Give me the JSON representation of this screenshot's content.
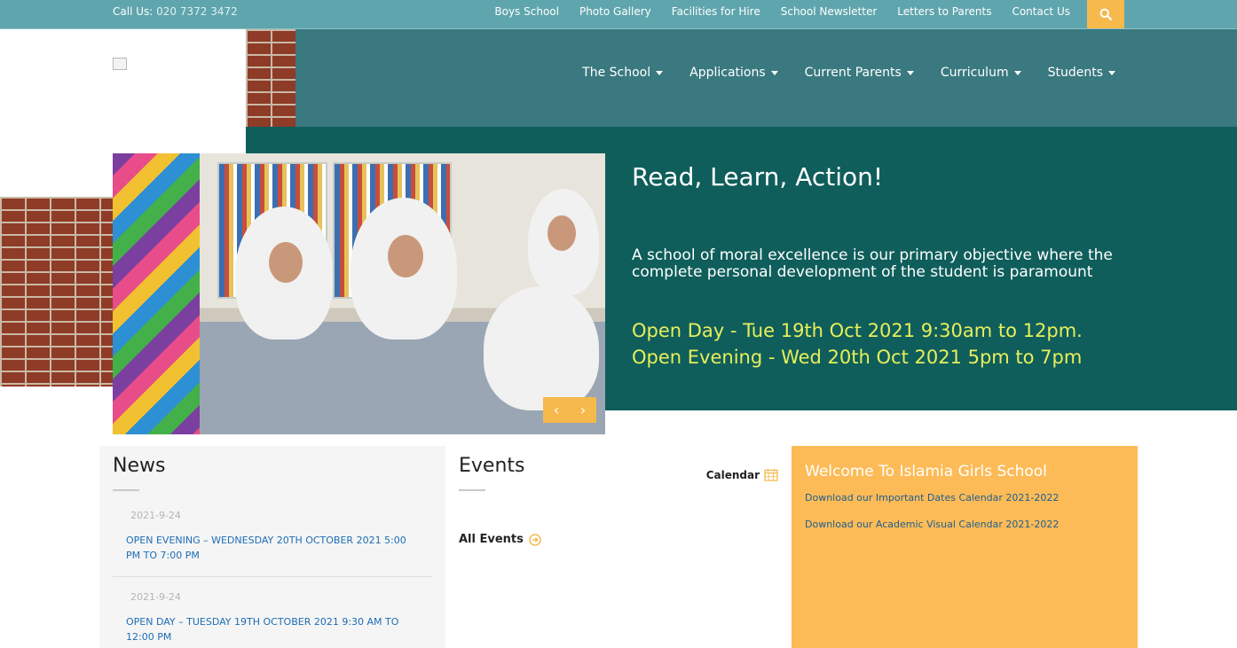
{
  "topbar": {
    "call_label": "Call Us:",
    "call_number": "020 7372 3472",
    "links": [
      "Boys School",
      "Photo Gallery",
      "Facilities for Hire",
      "School Newsletter",
      "Letters to Parents",
      "Contact Us"
    ]
  },
  "nav": {
    "items": [
      "The School",
      "Applications",
      "Current Parents",
      "Curriculum",
      "Students"
    ]
  },
  "hero": {
    "title": "Read, Learn, Action!",
    "description": "A school of moral excellence is our primary objective where the complete personal development of the student is paramount",
    "open_day": "Open Day - Tue 19th Oct 2021 9:30am to 12pm.",
    "open_evening": "Open Evening - Wed 20th Oct 2021 5pm to 7pm",
    "prev_glyph": "‹",
    "next_glyph": "›"
  },
  "news": {
    "title": "News",
    "items": [
      {
        "date": "2021-9-24",
        "text": "OPEN EVENING – WEDNESDAY 20TH OCTOBER 2021 5:00 PM TO 7:00 PM"
      },
      {
        "date": "2021-9-24",
        "text": "OPEN DAY – TUESDAY 19TH OCTOBER 2021  9:30 AM TO 12:00 PM"
      }
    ]
  },
  "events": {
    "title": "Events",
    "calendar_label": "Calendar",
    "all_events_label": "All Events"
  },
  "welcome": {
    "title": "Welcome To Islamia Girls School",
    "links": [
      "Download our Important Dates Calendar 2021-2022",
      "Download our Academic Visual Calendar 2021-2022"
    ]
  },
  "colors": {
    "topbar": "#5fa5ad",
    "header": "#39797f",
    "hero": "#0f5e5b",
    "accent": "#f6b94c",
    "welcome": "#fdbb57",
    "highlight_text": "#e8ef5a"
  }
}
